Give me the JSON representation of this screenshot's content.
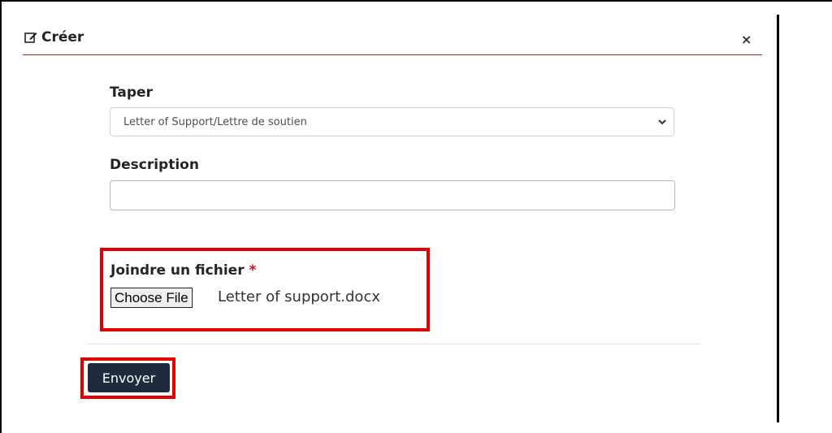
{
  "modal": {
    "title": "Créer",
    "title_icon": "edit-icon",
    "close_label": "×"
  },
  "form": {
    "type_label": "Taper",
    "type_selected": "Letter of Support/Lettre de soutien",
    "description_label": "Description",
    "description_value": "",
    "attach_label": "Joindre un fichier",
    "required_mark": "*",
    "choose_file_label": "Choose File",
    "file_name": "Letter of support.docx",
    "submit_label": "Envoyer"
  },
  "colors": {
    "accent_rule": "#b71c1c",
    "highlight": "#e00000",
    "submit_bg": "#1e2b3c",
    "required": "#c0121d"
  }
}
